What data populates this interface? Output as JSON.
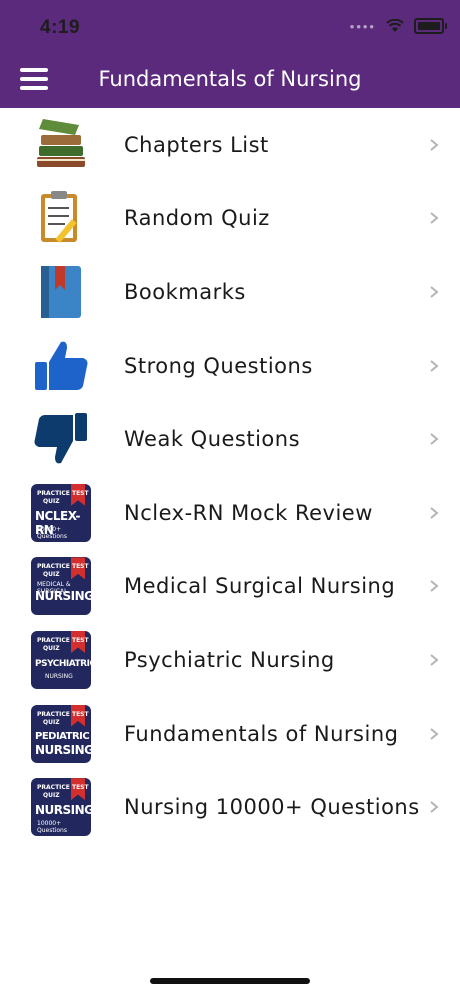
{
  "status_bar": {
    "time": "4:19"
  },
  "header": {
    "title": "Fundamentals of Nursing"
  },
  "items": [
    {
      "label": "Chapters List",
      "icon": "books-icon"
    },
    {
      "label": "Random Quiz",
      "icon": "quiz-clipboard-icon"
    },
    {
      "label": "Bookmarks",
      "icon": "bookmark-book-icon"
    },
    {
      "label": "Strong Questions",
      "icon": "thumbs-up-icon"
    },
    {
      "label": "Weak Questions",
      "icon": "thumbs-down-icon"
    },
    {
      "label": "Nclex-RN Mock Review",
      "icon": "nclex-badge-icon",
      "badge": {
        "t1": "PRACTICE TEST",
        "t2": "QUIZ",
        "t3": "NCLEX-RN",
        "t4": "10000+ Questions"
      }
    },
    {
      "label": "Medical Surgical Nursing",
      "icon": "med-surg-badge-icon",
      "badge": {
        "t1": "PRACTICE TEST",
        "t2": "QUIZ",
        "t3": "NURSING",
        "t4": "MEDICAL & SURGICAL"
      }
    },
    {
      "label": "Psychiatric Nursing",
      "icon": "psychiatric-badge-icon",
      "badge": {
        "t1": "PRACTICE TEST",
        "t2": "QUIZ",
        "t3": "PSYCHIATRIC",
        "t4": "NURSING"
      }
    },
    {
      "label": "Fundamentals of Nursing",
      "icon": "pediatric-badge-icon",
      "badge": {
        "t1": "PRACTICE TEST",
        "t2": "QUIZ",
        "t3": "PEDIATRIC",
        "t4": "NURSING"
      }
    },
    {
      "label": "Nursing 10000+ Questions",
      "icon": "nursing-badge-icon",
      "badge": {
        "t1": "PRACTICE TEST",
        "t2": "QUIZ",
        "t3": "NURSING",
        "t4": "10000+ Questions"
      }
    }
  ],
  "colors": {
    "header_bg": "#5b2a7d",
    "badge_bg": "#22285e",
    "ribbon": "#d32f2f",
    "thumb_up": "#1e63c9",
    "thumb_down": "#0d3b6e"
  }
}
